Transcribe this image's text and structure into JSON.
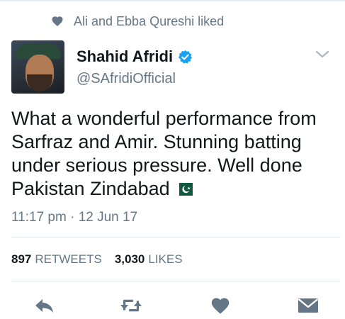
{
  "social_context": {
    "text": "Ali and Ebba Qureshi liked",
    "icon": "heart-icon"
  },
  "author": {
    "name": "Shahid Afridi",
    "handle": "@SAfridiOfficial",
    "verified": true,
    "verified_color": "#1da1f2"
  },
  "tweet": {
    "lines": [
      "What a wonderful performance from",
      "Sarfraz and Amir. Stunning batting",
      "under serious pressure. Well done",
      "Pakistan Zindabad"
    ],
    "emoji": "flag-pakistan",
    "timestamp": "11:17 pm · 12 Jun 17"
  },
  "stats": {
    "retweets_count": "897",
    "retweets_label": "RETWEETS",
    "likes_count": "3,030",
    "likes_label": "LIKES"
  },
  "actions": [
    "reply-icon",
    "retweet-icon",
    "like-icon",
    "message-icon"
  ],
  "colors": {
    "text": "#14171a",
    "secondary": "#657786",
    "divider": "#e1e8ed",
    "action": "#657786"
  }
}
